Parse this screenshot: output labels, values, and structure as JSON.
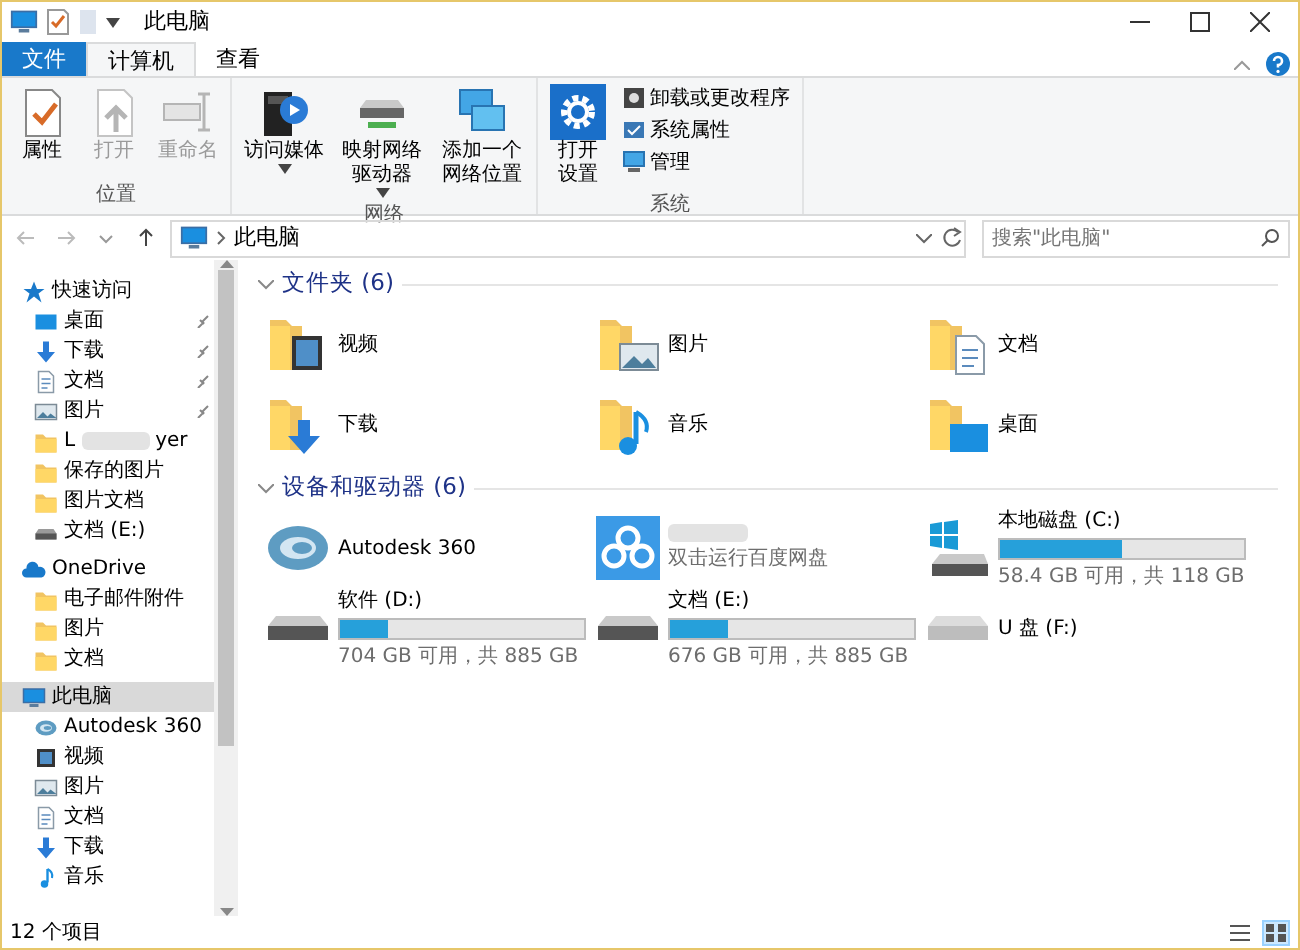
{
  "window": {
    "title": "此电脑"
  },
  "ribbon_tabs": [
    {
      "label": "文件",
      "kind": "file",
      "selected": false
    },
    {
      "label": "计算机",
      "kind": "tab",
      "selected": true
    },
    {
      "label": "查看",
      "kind": "tab",
      "selected": false
    }
  ],
  "ribbon_groups": [
    {
      "label": "位置",
      "buttons": [
        {
          "label": "属性",
          "kind": "properties",
          "disabled": false
        },
        {
          "label": "打开",
          "kind": "open",
          "disabled": true
        },
        {
          "label": "重命名",
          "kind": "rename",
          "disabled": true
        }
      ]
    },
    {
      "label": "网络",
      "buttons": [
        {
          "label": "访问媒体",
          "kind": "media",
          "disabled": false,
          "dropdown": true
        },
        {
          "label": "映射网络驱动器",
          "kind": "netdrive",
          "disabled": false,
          "dropdown": true
        },
        {
          "label": "添加一个网络位置",
          "kind": "netloc",
          "disabled": false,
          "dropdown": false
        }
      ]
    },
    {
      "label": "系统",
      "buttons": [
        {
          "label": "打开设置",
          "kind": "settings",
          "disabled": false,
          "dropdown": false
        }
      ],
      "small_buttons": [
        {
          "label": "卸载或更改程序",
          "kind": "uninstall"
        },
        {
          "label": "系统属性",
          "kind": "sysprops"
        },
        {
          "label": "管理",
          "kind": "manage"
        }
      ]
    }
  ],
  "address": {
    "path": "此电脑"
  },
  "search": {
    "placeholder": "搜索\"此电脑\""
  },
  "sidebar": [
    {
      "label": "快速访问",
      "kind": "star",
      "selected": false,
      "children": [
        {
          "label": "桌面",
          "kind": "desktop",
          "pinned": true,
          "selected": false
        },
        {
          "label": "下载",
          "kind": "download",
          "pinned": true,
          "selected": false
        },
        {
          "label": "文档",
          "kind": "doc",
          "pinned": true,
          "selected": false
        },
        {
          "label": "图片",
          "kind": "picture",
          "pinned": true,
          "selected": false
        },
        {
          "label": "L",
          "label_end": "yer",
          "kind": "folder",
          "pinned": false,
          "selected": false
        },
        {
          "label": "保存的图片",
          "kind": "folder",
          "pinned": false,
          "selected": false
        },
        {
          "label": "图片文档",
          "kind": "folder",
          "pinned": false,
          "selected": false
        },
        {
          "label": "文档 (E:)",
          "kind": "drive",
          "pinned": false,
          "selected": false
        }
      ]
    },
    {
      "label": "OneDrive",
      "kind": "cloud",
      "selected": false,
      "children": [
        {
          "label": "电子邮件附件",
          "kind": "folder",
          "selected": false
        },
        {
          "label": "图片",
          "kind": "folder",
          "selected": false
        },
        {
          "label": "文档",
          "kind": "folder",
          "selected": false
        }
      ]
    },
    {
      "label": "此电脑",
      "kind": "pc",
      "selected": true,
      "children": [
        {
          "label": "Autodesk 360",
          "kind": "autodesk",
          "selected": false
        },
        {
          "label": "视频",
          "kind": "video",
          "selected": false
        },
        {
          "label": "图片",
          "kind": "picture",
          "selected": false
        },
        {
          "label": "文档",
          "kind": "doc",
          "selected": false
        },
        {
          "label": "下载",
          "kind": "download",
          "selected": false
        },
        {
          "label": "音乐",
          "kind": "music",
          "selected": false
        }
      ]
    }
  ],
  "sections": [
    {
      "title": "文件夹 (6)",
      "expanded": true,
      "items": [
        {
          "name": "视频",
          "kind": "video"
        },
        {
          "name": "图片",
          "kind": "picture"
        },
        {
          "name": "文档",
          "kind": "doc"
        },
        {
          "name": "下载",
          "kind": "download"
        },
        {
          "name": "音乐",
          "kind": "music"
        },
        {
          "name": "桌面",
          "kind": "desktop"
        }
      ]
    },
    {
      "title": "设备和驱动器 (6)",
      "expanded": true,
      "items": [
        {
          "name": "Autodesk 360",
          "kind": "autodesk"
        },
        {
          "subtitle": "双击运行百度网盘",
          "kind": "cloudapp"
        },
        {
          "name": "本地磁盘 (C:)",
          "kind": "system-drive",
          "level": 0.5,
          "free": "58.4 GB 可用，共 118 GB"
        },
        {
          "name": "软件 (D:)",
          "kind": "drive",
          "level": 0.2,
          "free": "704 GB 可用，共 885 GB"
        },
        {
          "name": "文档 (E:)",
          "kind": "drive",
          "level": 0.24,
          "free": "676 GB 可用，共 885 GB"
        },
        {
          "name": "U 盘 (F:)",
          "kind": "usb"
        }
      ]
    }
  ],
  "status_bar": {
    "count": "12 个项目"
  },
  "view_buttons": [
    {
      "kind": "details",
      "selected": false
    },
    {
      "kind": "tiles",
      "selected": true
    }
  ]
}
